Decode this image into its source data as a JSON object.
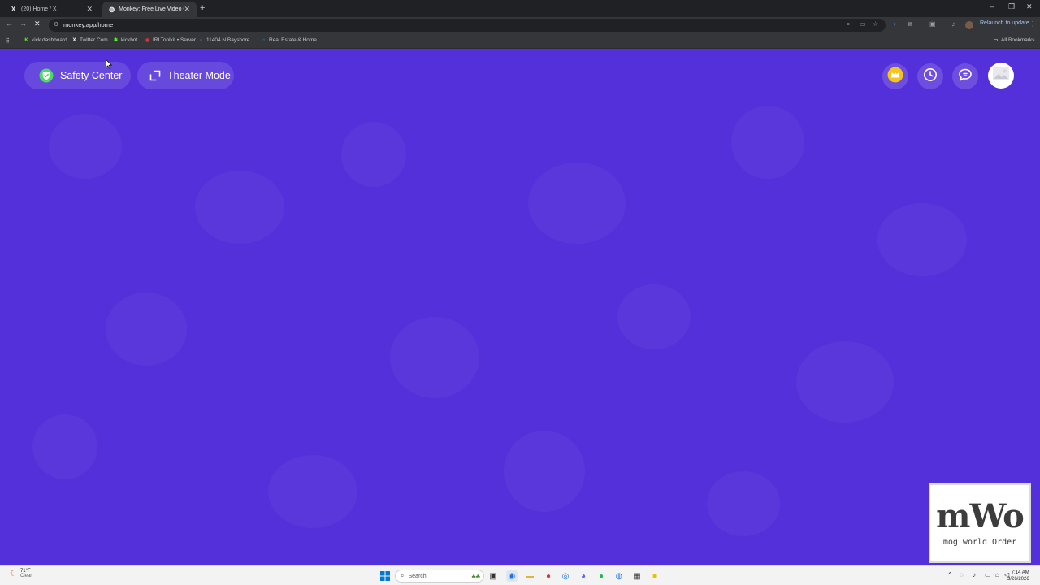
{
  "browser": {
    "tabs": [
      {
        "title": "(20) Home / X",
        "favicon": "x-logo-icon",
        "active": false
      },
      {
        "title": "Monkey: Free Live Video Chat &",
        "favicon": "globe-icon",
        "active": true
      }
    ],
    "new_tab_label": "+",
    "address_url": "monkey.app/home",
    "relaunch_label": "Relaunch to update",
    "bookmarks": [
      {
        "label": "kick dashboard",
        "icon": "kick-icon",
        "color": "#53fc18"
      },
      {
        "label": "Twitter Com",
        "icon": "x-logo-icon",
        "color": "#ffffff"
      },
      {
        "label": "kickbot",
        "icon": "kickbot-icon",
        "color": "#53fc18"
      },
      {
        "label": "IRLToolkit • Server",
        "icon": "irltoolkit-icon",
        "color": "#d03a3a"
      },
      {
        "label": "11404 N Bayshore...",
        "icon": "home-icon",
        "color": "#4a8cf7"
      },
      {
        "label": "Real Estate & Home...",
        "icon": "home-icon",
        "color": "#4a8cf7"
      }
    ],
    "all_bookmarks_label": "All Bookmarks"
  },
  "page": {
    "background_color": "#5430da",
    "safety_center_label": "Safety Center",
    "theater_mode_label": "Theater Mode",
    "right_buttons": [
      "crown-icon",
      "history-icon",
      "chat-icon",
      "profile-avatar"
    ],
    "watermark": {
      "main": "mWo",
      "sub": "mog world Order"
    }
  },
  "taskbar": {
    "weather_temp": "71°F",
    "weather_condition": "Clear",
    "search_placeholder": "Search",
    "time": "7:14 AM",
    "date": "3/26/2026"
  }
}
